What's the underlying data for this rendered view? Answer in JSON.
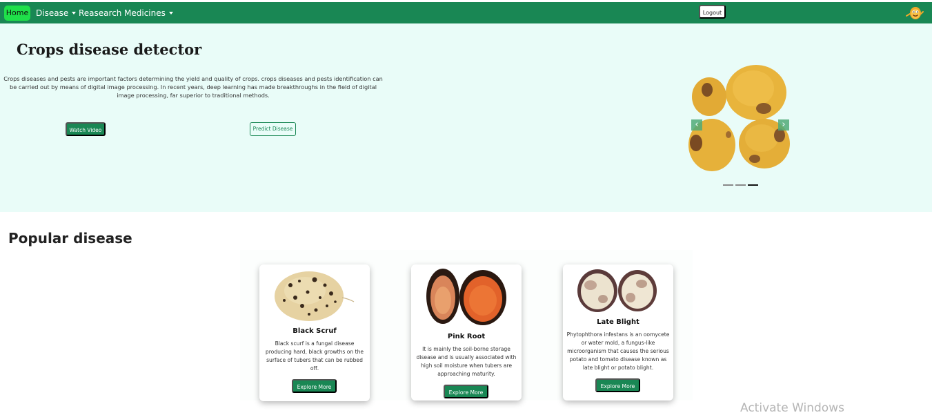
{
  "nav": {
    "home": "Home",
    "disease": "Disease",
    "research": "Reasearch",
    "medicines": "Medicines",
    "logout": "Logout",
    "avatar_icon": "potato-mascot-icon",
    "brand_color": "#198754",
    "home_bg": "#1fe04a"
  },
  "hero": {
    "title": "Crops disease detector",
    "description": "Crops diseases and pests are important factors determining the yield and quality of crops. crops diseases and pests identification can be carried out by means of digital image processing. In recent years, deep learning has made breakthroughs in the field of digital image processing, far superior to traditional methods.",
    "watch_video": "Watch Video",
    "predict_disease": "Predict Disease",
    "background": "#e9fcf8",
    "carousel": {
      "prev_icon": "chevron-left-icon",
      "next_icon": "chevron-right-icon",
      "slide_count": 3,
      "active_slide": 3
    }
  },
  "popular": {
    "title": "Popular disease",
    "cards": [
      {
        "name": "Black Scruf",
        "text": "Black scurf is a fungal disease producing hard, black growths on the surface of tubers that can be rubbed off.",
        "button": "Explore More"
      },
      {
        "name": "Pink Root",
        "text": "It is mainly the soil-borne storage disease and is usually associated with high soil moisture when tubers are approaching maturity.",
        "button": "Explore More"
      },
      {
        "name": "Late Blight",
        "text": "Phytophthora infestans is an oomycete or water mold, a fungus-like microorganism that causes the serious potato and tomato disease known as late blight or potato blight.",
        "button": "Explore More"
      }
    ]
  },
  "watermark": "Activate Windows"
}
